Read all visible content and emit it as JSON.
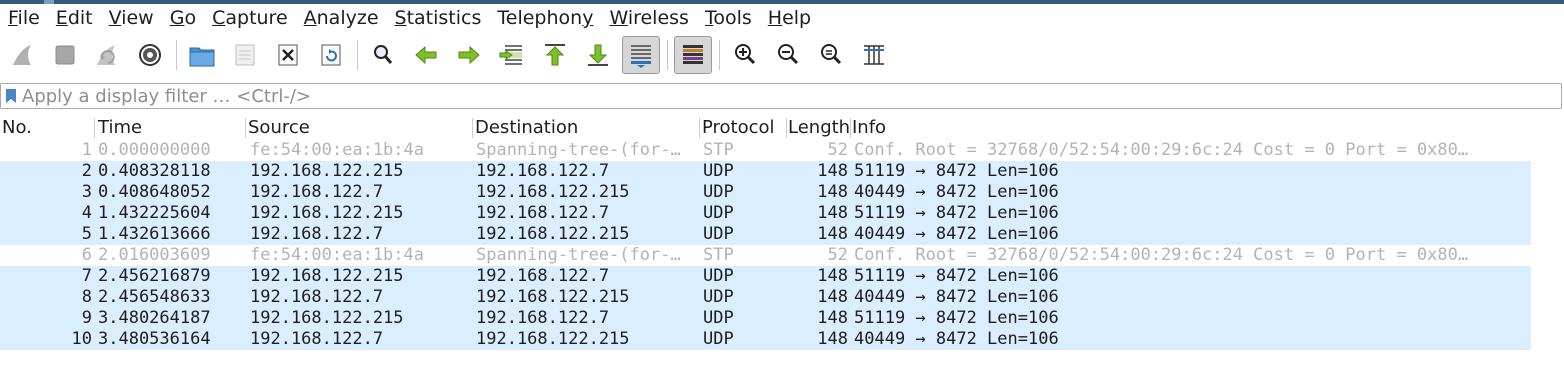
{
  "menubar": {
    "items": [
      "File",
      "Edit",
      "View",
      "Go",
      "Capture",
      "Analyze",
      "Statistics",
      "Telephony",
      "Wireless",
      "Tools",
      "Help"
    ]
  },
  "toolbar": {
    "icons": [
      "start-capture",
      "stop-capture",
      "restart-capture",
      "capture-options",
      "open-file",
      "save-file",
      "close-file",
      "reload-file",
      "find-packet",
      "go-back",
      "go-forward",
      "go-to-packet",
      "go-to-first-packet",
      "go-to-last-packet",
      "auto-scroll",
      "colorize",
      "zoom-in",
      "zoom-out",
      "normal-size",
      "resize-columns"
    ]
  },
  "filter": {
    "placeholder": "Apply a display filter … <Ctrl-/>",
    "value": ""
  },
  "columns": {
    "no": "No.",
    "time": "Time",
    "source": "Source",
    "destination": "Destination",
    "protocol": "Protocol",
    "length": "Length",
    "info": "Info"
  },
  "colors": {
    "udp_row": "#daeeff",
    "stp_row": "#ffffff",
    "stp_text": "#b3b3b3"
  },
  "packets": [
    {
      "no": "1",
      "time": "0.000000000",
      "source": "fe:54:00:ea:1b:4a",
      "destination": "Spanning-tree-(for-…",
      "protocol": "STP",
      "length": "52",
      "info": "Conf. Root = 32768/0/52:54:00:29:6c:24  Cost = 0  Port = 0x80…"
    },
    {
      "no": "2",
      "time": "0.408328118",
      "source": "192.168.122.215",
      "destination": "192.168.122.7",
      "protocol": "UDP",
      "length": "148",
      "info": "51119 → 8472 Len=106"
    },
    {
      "no": "3",
      "time": "0.408648052",
      "source": "192.168.122.7",
      "destination": "192.168.122.215",
      "protocol": "UDP",
      "length": "148",
      "info": "40449 → 8472 Len=106"
    },
    {
      "no": "4",
      "time": "1.432225604",
      "source": "192.168.122.215",
      "destination": "192.168.122.7",
      "protocol": "UDP",
      "length": "148",
      "info": "51119 → 8472 Len=106"
    },
    {
      "no": "5",
      "time": "1.432613666",
      "source": "192.168.122.7",
      "destination": "192.168.122.215",
      "protocol": "UDP",
      "length": "148",
      "info": "40449 → 8472 Len=106"
    },
    {
      "no": "6",
      "time": "2.016003609",
      "source": "fe:54:00:ea:1b:4a",
      "destination": "Spanning-tree-(for-…",
      "protocol": "STP",
      "length": "52",
      "info": "Conf. Root = 32768/0/52:54:00:29:6c:24  Cost = 0  Port = 0x80…"
    },
    {
      "no": "7",
      "time": "2.456216879",
      "source": "192.168.122.215",
      "destination": "192.168.122.7",
      "protocol": "UDP",
      "length": "148",
      "info": "51119 → 8472 Len=106"
    },
    {
      "no": "8",
      "time": "2.456548633",
      "source": "192.168.122.7",
      "destination": "192.168.122.215",
      "protocol": "UDP",
      "length": "148",
      "info": "40449 → 8472 Len=106"
    },
    {
      "no": "9",
      "time": "3.480264187",
      "source": "192.168.122.215",
      "destination": "192.168.122.7",
      "protocol": "UDP",
      "length": "148",
      "info": "51119 → 8472 Len=106"
    },
    {
      "no": "10",
      "time": "3.480536164",
      "source": "192.168.122.7",
      "destination": "192.168.122.215",
      "protocol": "UDP",
      "length": "148",
      "info": "40449 → 8472 Len=106"
    }
  ]
}
